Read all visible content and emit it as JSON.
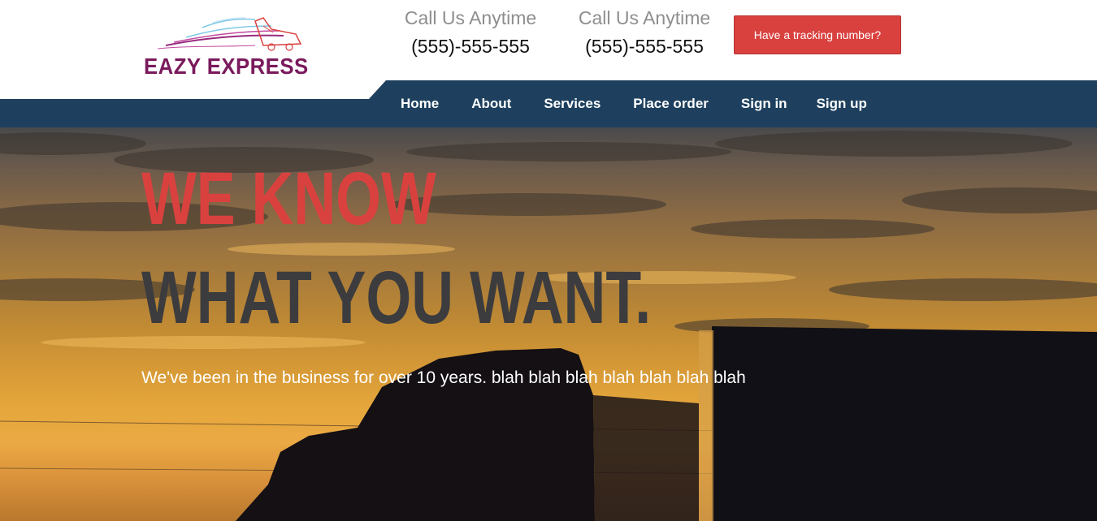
{
  "header": {
    "logo": {
      "icon": "truck-logo-icon",
      "text": "EAZY EXPRESS",
      "color": "#7a1a5c"
    },
    "calls": [
      {
        "label": "Call Us Anytime",
        "phone": "(555)-555-555"
      },
      {
        "label": "Call Us Anytime",
        "phone": "(555)-555-555"
      }
    ],
    "tracking_button_label": "Have a tracking number?",
    "accent_color": "#d9413f"
  },
  "nav": {
    "background_color": "#1e405e",
    "items": [
      {
        "label": "Home"
      },
      {
        "label": "About"
      },
      {
        "label": "Services"
      },
      {
        "label": "Place order"
      },
      {
        "label": "Sign in"
      },
      {
        "label": "Sign up"
      }
    ]
  },
  "hero": {
    "headline_line1": "WE KNOW",
    "headline_line2": "WHAT YOU WANT.",
    "subtitle": "We've been in the business for over 10 years. blah blah blah blah blah blah blah",
    "background": "sunset-truck-silhouette-image",
    "line1_color": "#d9413f",
    "line2_color": "#3c3c3e"
  }
}
